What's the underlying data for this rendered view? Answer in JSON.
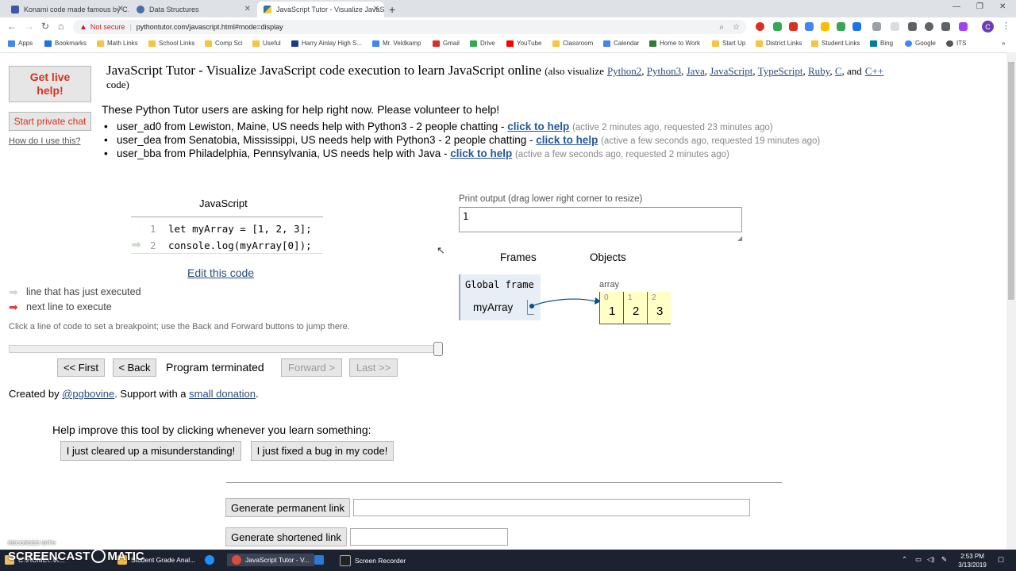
{
  "browser": {
    "tabs": [
      {
        "title": "Konami code made famous by C...",
        "icon": "konami-favicon",
        "active": false
      },
      {
        "title": "Data Structures",
        "icon": "globe-favicon",
        "active": false
      },
      {
        "title": "JavaScript Tutor - Visualize JavaS...",
        "icon": "python-tutor-favicon",
        "active": true
      }
    ],
    "new_tab": "+",
    "security": "Not secure",
    "url": "pythontutor.com/javascript.html#mode=display",
    "bookmarks": [
      "Apps",
      "Bookmarks",
      "Math Links",
      "School Links",
      "Comp Sci",
      "Useful",
      "Harry Ainlay High S...",
      "Mr. Veldkamp",
      "Gmail",
      "Drive",
      "YouTube",
      "Classroom",
      "Calendar",
      "Home to Work",
      "Start Up",
      "District Links",
      "Student Links",
      "Bing",
      "Google",
      "ITS"
    ],
    "profile_initial": "C"
  },
  "sidebar": {
    "get_live_help": "Get live help!",
    "start_private_chat": "Start private chat",
    "how_to_use": "How do I use this?"
  },
  "header": {
    "title": "JavaScript Tutor - Visualize JavaScript code execution to learn JavaScript online",
    "also": "(also visualize",
    "langs": [
      "Python2",
      "Python3",
      "Java",
      "JavaScript",
      "TypeScript",
      "Ruby",
      "C"
    ],
    "and": "and",
    "last_lang": "C++",
    "code_suffix": "code)"
  },
  "help_requests": {
    "intro": "These Python Tutor users are asking for help right now. Please volunteer to help!",
    "items": [
      {
        "text": "user_ad0 from Lewiston, Maine, US needs help with Python3 - 2 people chatting -",
        "link": "click to help",
        "meta": "(active 2 minutes ago, requested 23 minutes ago)"
      },
      {
        "text": "user_dea from Senatobia, Mississippi, US needs help with Python3 - 2 people chatting -",
        "link": "click to help",
        "meta": "(active a few seconds ago, requested 19 minutes ago)"
      },
      {
        "text": "user_bba from Philadelphia, Pennsylvania, US needs help with Java -",
        "link": "click to help",
        "meta": "(active a few seconds ago, requested 2 minutes ago)"
      }
    ]
  },
  "code_panel": {
    "language": "JavaScript",
    "lines": [
      {
        "num": "1",
        "code": "let myArray = [1, 2, 3];"
      },
      {
        "num": "2",
        "code": "console.log(myArray[0]);"
      }
    ],
    "edit_link": "Edit this code",
    "legend_executed": "line that has just executed",
    "legend_next": "next line to execute",
    "breakpoint_hint": "Click a line of code to set a breakpoint; use the Back and Forward buttons to jump there.",
    "slider_position": 1.0,
    "first": "<< First",
    "back": "< Back",
    "status": "Program terminated",
    "forward": "Forward >",
    "last": "Last >>",
    "created_by": "Created by",
    "author": "@pgbovine",
    "support": ". Support with a",
    "donation": "small donation",
    "period": "."
  },
  "output_panel": {
    "print_label": "Print output (drag lower right corner to resize)",
    "print_value": "1",
    "frames_heading": "Frames",
    "objects_heading": "Objects",
    "global_frame": "Global frame",
    "var_name": "myArray",
    "array_label": "array",
    "array_indices": [
      "0",
      "1",
      "2"
    ],
    "array_values": [
      "1",
      "2",
      "3"
    ]
  },
  "feedback": {
    "prompt": "Help improve this tool by clicking whenever you learn something:",
    "btn1": "I just cleared up a misunderstanding!",
    "btn2": "I just fixed a bug in my code!"
  },
  "links": {
    "permanent": "Generate permanent link",
    "shortened": "Generate shortened link"
  },
  "watermark": {
    "small": "RECORDED WITH",
    "big": "SCREENCAST",
    "big2": "MATIC"
  },
  "taskbar": {
    "items": [
      "C:\\HOME\\..\\K...",
      "Student Grade Anal...",
      "",
      "JavaScript Tutor - V...",
      "",
      "Screen Recorder"
    ],
    "time": "2:53 PM",
    "date": "3/13/2019"
  },
  "colors": {
    "arrow_next": "#e04040",
    "arrow_done": "#c8dcc8",
    "frame_bg": "#e8eef5",
    "array_bg": "#ffffc6",
    "link": "#2b4c80"
  }
}
